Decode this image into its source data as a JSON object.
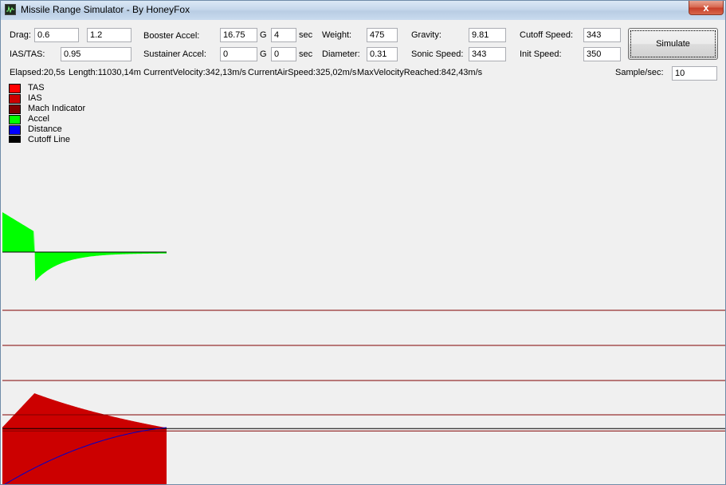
{
  "window": {
    "title": "Missile Range Simulator - By HoneyFox",
    "close_label": "x"
  },
  "params": {
    "drag_label": "Drag:",
    "drag_a": "0.6",
    "drag_b": "1.2",
    "ias_tas_label": "IAS/TAS:",
    "ias_tas": "0.95",
    "booster_label": "Booster Accel:",
    "booster_g": "16.75",
    "booster_g_unit": "G",
    "booster_sec": "4",
    "booster_sec_unit": "sec",
    "sustainer_label": "Sustainer Accel:",
    "sustainer_g": "0",
    "sustainer_g_unit": "G",
    "sustainer_sec": "0",
    "sustainer_sec_unit": "sec",
    "weight_label": "Weight:",
    "weight": "475",
    "diameter_label": "Diameter:",
    "diameter": "0.31",
    "gravity_label": "Gravity:",
    "gravity": "9.81",
    "sonic_label": "Sonic Speed:",
    "sonic": "343",
    "cutoff_label": "Cutoff Speed:",
    "cutoff": "343",
    "init_label": "Init Speed:",
    "init": "350",
    "simulate_label": "Simulate",
    "sample_label": "Sample/sec:",
    "sample": "10"
  },
  "status": {
    "elapsed": "Elapsed:20,5s",
    "length": "Length:11030,14m",
    "current_velocity": "CurrentVelocity:342,13m/s",
    "current_air_speed": "CurrentAirSpeed:325,02m/s",
    "max_velocity": "MaxVelocityReached:842,43m/s"
  },
  "legend": [
    {
      "label": "TAS",
      "color": "#ff0000"
    },
    {
      "label": "IAS",
      "color": "#cc0000"
    },
    {
      "label": "Mach Indicator",
      "color": "#800000"
    },
    {
      "label": "Accel",
      "color": "#00ff00"
    },
    {
      "label": "Distance",
      "color": "#0000ff"
    },
    {
      "label": "Cutoff Line",
      "color": "#000000"
    }
  ],
  "colors": {
    "tas_fill": "#cc0000",
    "accel_fill": "#00ff00",
    "distance_line": "#0000cc",
    "mach_line": "#800000",
    "cutoff_line": "#000000",
    "axis": "#000000"
  },
  "sim": {
    "duration_s": 20.5,
    "burn_s": 4,
    "accel_boost_ms2": 164.3,
    "accel_min_ms2": -123,
    "accel_end_ms2": -5,
    "speed_init_ms": 350,
    "speed_peak_ms": 842.43,
    "speed_end_ms": 342.13,
    "distance_end_m": 11030.14,
    "mach_levels": [
      1,
      2,
      3,
      4
    ],
    "cutoff_speed_ms": 343
  }
}
